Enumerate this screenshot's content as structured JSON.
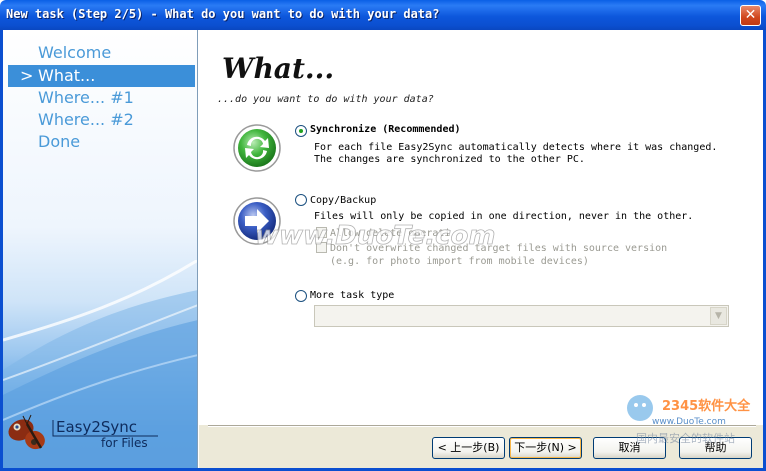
{
  "window": {
    "title": "New task (Step 2/5) - What do you want to do with your data?",
    "close_glyph": "✕"
  },
  "sidebar": {
    "items": [
      {
        "label": "Welcome"
      },
      {
        "label": "What...",
        "arrow": ">"
      },
      {
        "label": "Where... #1"
      },
      {
        "label": "Where... #2"
      },
      {
        "label": "Done"
      }
    ],
    "logo": {
      "name": "Easy2Sync",
      "sub": "for Files",
      "icon": "butterfly-icon"
    }
  },
  "main": {
    "title": "What...",
    "subtitle": "...do you want to do with your data?",
    "options": {
      "sync": {
        "label": "Synchronize (Recommended)",
        "checked": true,
        "icon": "sync-arrows-icon",
        "desc1": "For each file Easy2Sync automatically detects where it was changed.",
        "desc2": "The changes are synchronized to the other PC."
      },
      "copy": {
        "label": "Copy/Backup",
        "checked": false,
        "icon": "arrow-right-icon",
        "desc1": "Files will only be copied in one direction, never in the other.",
        "allow_delete": "Allow delete operati",
        "no_overwrite": "Don't overwrite changed target files with source version",
        "no_overwrite_hint": "(e.g. for photo import from mobile devices)"
      },
      "more": {
        "label": "More task type",
        "checked": false
      }
    }
  },
  "buttons": {
    "back": "< 上一步(B)",
    "next": "下一步(N) >",
    "cancel": "取消",
    "help": "帮助"
  },
  "colors": {
    "titlebar": "#0b4fd0",
    "sidebar_active": "#3b8fd9",
    "nav_text": "#4a9ad8",
    "sync_green": "#2fa32f",
    "copy_blue": "#2146a8"
  },
  "watermarks": {
    "center": "www.DuoTe.com",
    "corner_brand": "2345软件大全",
    "corner_url": "www.DuoTe.com",
    "corner_tag": "国内最安全的软件站"
  }
}
